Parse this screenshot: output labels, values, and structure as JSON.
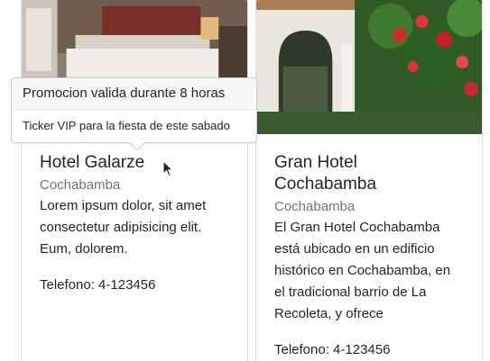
{
  "popover": {
    "title": "Promocion valida durante 8 horas",
    "body": "Ticker VIP para la fiesta de este sabado"
  },
  "cards": [
    {
      "title": "Hotel Galarze",
      "city": "Cochabamba",
      "description": "Lorem ipsum dolor, sit amet consectetur adipisicing elit. Eum, dolorem.",
      "phone": "Telefono: 4-123456"
    },
    {
      "title": "Gran Hotel Cochabamba",
      "city": "Cochabamba",
      "description": "El Gran Hotel Cochabamba está ubicado en un edificio histórico en Cochabamba, en el tradicional barrio de La Recoleta, y ofrece",
      "phone": "Telefono: 4-123456"
    }
  ]
}
